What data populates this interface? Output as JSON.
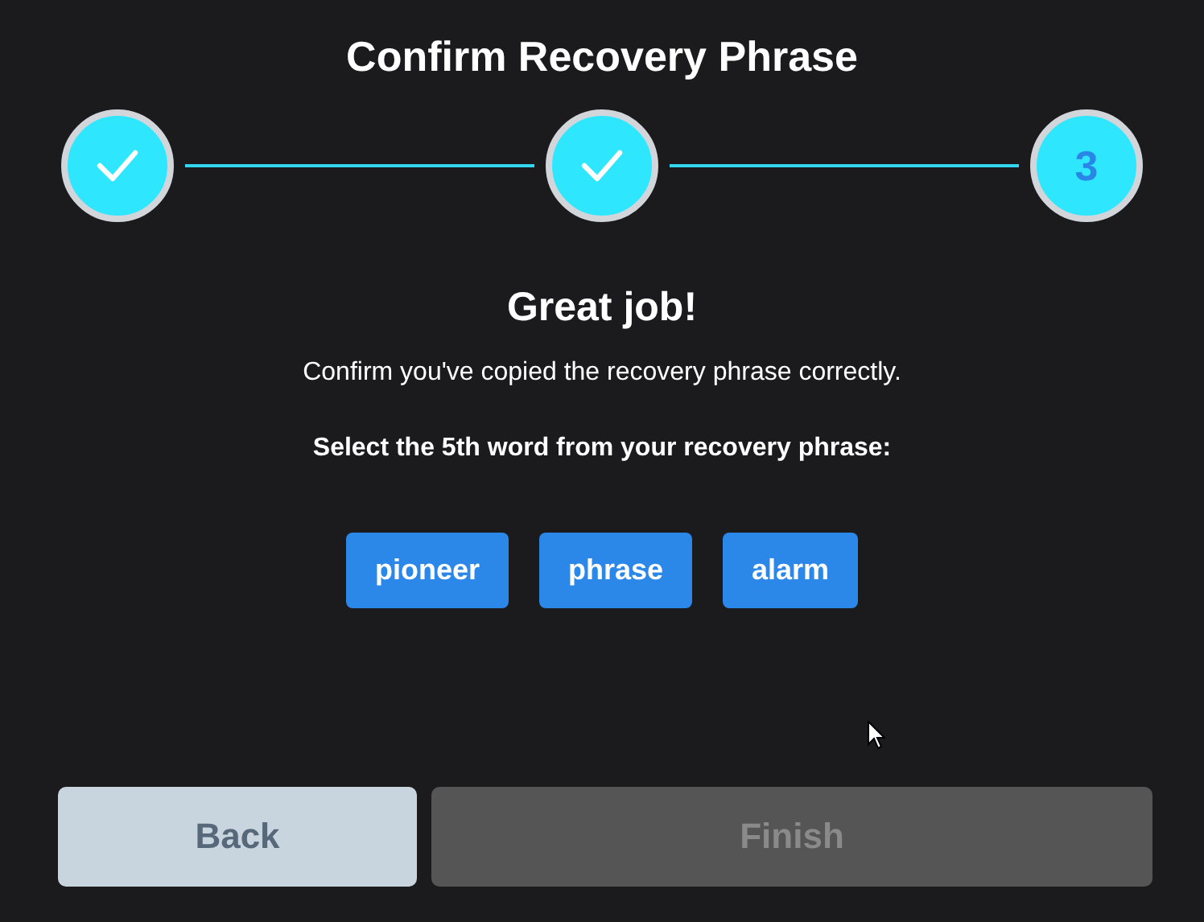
{
  "title": "Confirm Recovery Phrase",
  "steps": [
    {
      "completed": true
    },
    {
      "completed": true
    },
    {
      "completed": false,
      "label": "3"
    }
  ],
  "heading": "Great job!",
  "message": "Confirm you've copied the recovery phrase correctly.",
  "prompt": "Select the 5th word from your recovery phrase:",
  "words": [
    "pioneer",
    "phrase",
    "alarm"
  ],
  "buttons": [
    {
      "label": "Back",
      "kind": "secondary",
      "disabled": false
    },
    {
      "label": "Finish",
      "kind": "primary",
      "disabled": true
    }
  ]
}
